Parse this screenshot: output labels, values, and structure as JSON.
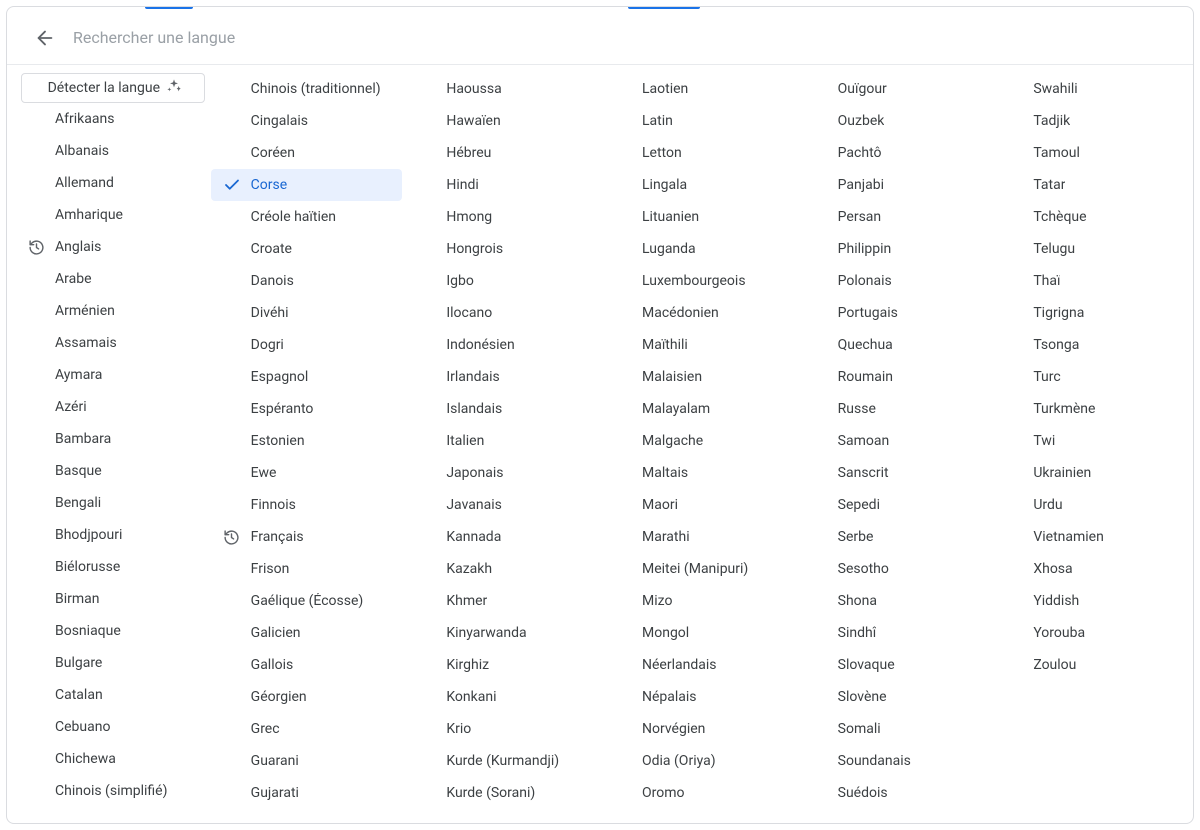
{
  "search": {
    "placeholder": "Rechercher une langue"
  },
  "detect_label": "Détecter la langue",
  "selected": "Corse",
  "recent": [
    "Anglais",
    "Français"
  ],
  "columns": [
    [
      "__DETECT__",
      "Afrikaans",
      "Albanais",
      "Allemand",
      "Amharique",
      "Anglais",
      "Arabe",
      "Arménien",
      "Assamais",
      "Aymara",
      "Azéri",
      "Bambara",
      "Basque",
      "Bengali",
      "Bhodjpouri",
      "Biélorusse",
      "Birman",
      "Bosniaque",
      "Bulgare",
      "Catalan",
      "Cebuano",
      "Chichewa",
      "Chinois (simplifié)"
    ],
    [
      "Chinois (traditionnel)",
      "Cingalais",
      "Coréen",
      "Corse",
      "Créole haïtien",
      "Croate",
      "Danois",
      "Divéhi",
      "Dogri",
      "Espagnol",
      "Espéranto",
      "Estonien",
      "Ewe",
      "Finnois",
      "Français",
      "Frison",
      "Gaélique (Écosse)",
      "Galicien",
      "Gallois",
      "Géorgien",
      "Grec",
      "Guarani",
      "Gujarati"
    ],
    [
      "Haoussa",
      "Hawaïen",
      "Hébreu",
      "Hindi",
      "Hmong",
      "Hongrois",
      "Igbo",
      "Ilocano",
      "Indonésien",
      "Irlandais",
      "Islandais",
      "Italien",
      "Japonais",
      "Javanais",
      "Kannada",
      "Kazakh",
      "Khmer",
      "Kinyarwanda",
      "Kirghiz",
      "Konkani",
      "Krio",
      "Kurde (Kurmandji)",
      "Kurde (Sorani)"
    ],
    [
      "Laotien",
      "Latin",
      "Letton",
      "Lingala",
      "Lituanien",
      "Luganda",
      "Luxembourgeois",
      "Macédonien",
      "Maïthili",
      "Malaisien",
      "Malayalam",
      "Malgache",
      "Maltais",
      "Maori",
      "Marathi",
      "Meitei (Manipuri)",
      "Mizo",
      "Mongol",
      "Néerlandais",
      "Népalais",
      "Norvégien",
      "Odia (Oriya)",
      "Oromo"
    ],
    [
      "Ouïgour",
      "Ouzbek",
      "Pachtô",
      "Panjabi",
      "Persan",
      "Philippin",
      "Polonais",
      "Portugais",
      "Quechua",
      "Roumain",
      "Russe",
      "Samoan",
      "Sanscrit",
      "Sepedi",
      "Serbe",
      "Sesotho",
      "Shona",
      "Sindhî",
      "Slovaque",
      "Slovène",
      "Somali",
      "Soundanais",
      "Suédois"
    ],
    [
      "Swahili",
      "Tadjik",
      "Tamoul",
      "Tatar",
      "Tchèque",
      "Telugu",
      "Thaï",
      "Tigrigna",
      "Tsonga",
      "Turc",
      "Turkmène",
      "Twi",
      "Ukrainien",
      "Urdu",
      "Vietnamien",
      "Xhosa",
      "Yiddish",
      "Yorouba",
      "Zoulou"
    ]
  ]
}
